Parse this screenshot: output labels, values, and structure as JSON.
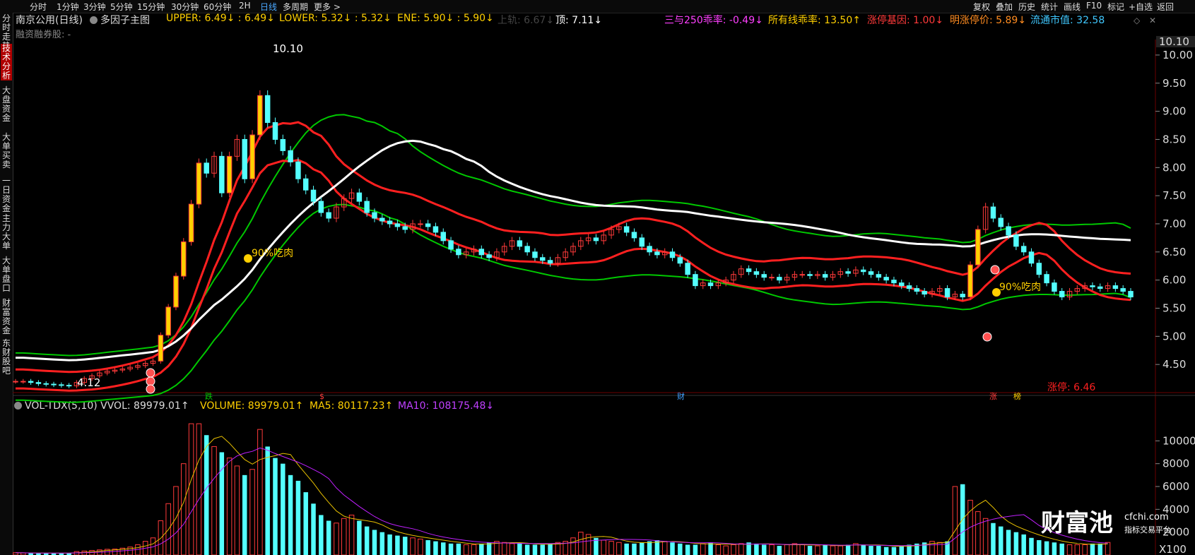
{
  "toolbar": {
    "periods": [
      "分时",
      "1分钟",
      "3分钟",
      "5分钟",
      "15分钟",
      "30分钟",
      "60分钟",
      "2H",
      "日线",
      "多周期",
      "更多 >"
    ],
    "actions": [
      "复权",
      "叠加",
      "历史",
      "统计",
      "画线",
      "F10",
      "标记",
      "+自选",
      "返回"
    ]
  },
  "sidebar": {
    "tabs": [
      "分时走势",
      "技术分析",
      "大盘资金",
      "大单买卖",
      "一日资金",
      "主力大单",
      "大单盘口",
      "财富资金",
      "东财股吧"
    ]
  },
  "header": {
    "stock_title": "南京公用(日线)",
    "indicator_name": "多因子主图",
    "upper": "UPPER: 6.49↓  : 6.49↓",
    "lower": "LOWER: 5.32↓  : 5.32↓",
    "ene": "ENE: 5.90↓  : 5.90↓",
    "shangui": "上轨: 6.67↓",
    "ding": "顶: 7.11↓",
    "sanyu": "三与250乖率: -0.49↓",
    "suoyou": "所有线乖率: 13.50↑",
    "zhangting_jiyin": "涨停基因: 1.00↓",
    "ming_zhangting": "明涨停价: 5.89↓",
    "liutong": "流通市值: 32.58",
    "margin": "融资融券股: -"
  },
  "colors": {
    "up": "#ff3a3a",
    "down": "#54ffff",
    "upper_band": "#ff2020",
    "outer_band": "#00c800",
    "mid_line": "#ffffff",
    "ma5": "#e8c000",
    "ma10": "#c020ff",
    "limit_up_bar": "#ffd000"
  },
  "price_axis": {
    "ticks": [
      "10.00",
      "9.50",
      "9.00",
      "8.50",
      "8.00",
      "7.50",
      "7.00",
      "6.50",
      "6.00",
      "5.50",
      "5.00",
      "4.50"
    ],
    "current_label": "10.10"
  },
  "annotations": {
    "high_label": "10.10",
    "low_label": "4.12",
    "chi_rou_1": "90%吃肉",
    "chi_rou_2": "90%吃肉",
    "limit_up_price": "涨停: 6.46",
    "marker_die": "跌",
    "marker_s": "$",
    "marker_cai": "财",
    "marker_zhang": "涨",
    "marker_bang": "榜"
  },
  "volume_panel": {
    "title": "VOL-TDX(5,10) VVOL: 89979.01↑",
    "volume": "VOLUME: 89979.01↑",
    "ma5": "MA5: 80117.23↑",
    "ma10": "MA10: 108175.48↓",
    "ticks": [
      "10000",
      "8000",
      "6000",
      "4000",
      "2000"
    ],
    "unit": "X100"
  },
  "watermark": {
    "brand": "财富池",
    "site": "cfchi.com",
    "slogan": "指标交易平台"
  },
  "chart_data": {
    "type": "candlestick",
    "ylim": [
      4.0,
      10.2
    ],
    "closes": [
      4.2,
      4.2,
      4.18,
      4.16,
      4.15,
      4.14,
      4.13,
      4.12,
      4.18,
      4.25,
      4.3,
      4.35,
      4.38,
      4.4,
      4.42,
      4.45,
      4.48,
      4.52,
      4.56,
      5.02,
      5.52,
      6.07,
      6.68,
      7.35,
      8.08,
      7.9,
      8.2,
      7.55,
      8.2,
      8.5,
      7.8,
      8.58,
      9.28,
      8.8,
      8.5,
      8.3,
      8.1,
      7.8,
      7.6,
      7.4,
      7.2,
      7.1,
      7.3,
      7.45,
      7.55,
      7.4,
      7.2,
      7.1,
      7.05,
      7.0,
      6.95,
      6.9,
      7.0,
      7.0,
      6.95,
      6.85,
      6.7,
      6.55,
      6.45,
      6.5,
      6.55,
      6.45,
      6.4,
      6.5,
      6.6,
      6.7,
      6.6,
      6.5,
      6.4,
      6.35,
      6.3,
      6.4,
      6.5,
      6.6,
      6.7,
      6.75,
      6.7,
      6.8,
      6.9,
      6.95,
      6.85,
      6.75,
      6.6,
      6.5,
      6.45,
      6.5,
      6.4,
      6.3,
      6.1,
      5.9,
      5.95,
      5.9,
      5.95,
      6.0,
      6.1,
      6.2,
      6.15,
      6.1,
      6.05,
      6.05,
      6.0,
      6.05,
      6.1,
      6.1,
      6.08,
      6.1,
      6.05,
      6.1,
      6.15,
      6.12,
      6.18,
      6.15,
      6.1,
      6.05,
      6.0,
      5.95,
      5.9,
      5.85,
      5.8,
      5.75,
      5.8,
      5.85,
      5.7,
      5.75,
      5.7,
      6.27,
      6.9,
      7.3,
      7.1,
      6.95,
      6.8,
      6.6,
      6.5,
      6.3,
      6.1,
      5.95,
      5.8,
      5.7,
      5.8,
      5.85,
      5.9,
      5.88,
      5.85,
      5.9,
      5.85,
      5.8,
      5.7
    ],
    "volumes": [
      200,
      180,
      160,
      150,
      150,
      160,
      170,
      180,
      300,
      350,
      400,
      450,
      500,
      520,
      600,
      700,
      900,
      1200,
      1500,
      3000,
      4500,
      6000,
      8000,
      11500,
      11500,
      10500,
      9500,
      9000,
      8500,
      7800,
      7000,
      7500,
      11000,
      9500,
      8500,
      8000,
      7000,
      6500,
      5500,
      4500,
      3500,
      3000,
      2800,
      3200,
      3500,
      3000,
      2500,
      2200,
      2000,
      1800,
      1700,
      1600,
      1500,
      1400,
      1300,
      1200,
      1100,
      1000,
      1000,
      900,
      900,
      1000,
      1100,
      1200,
      1100,
      1000,
      1000,
      900,
      900,
      900,
      1000,
      1100,
      1200,
      1500,
      2000,
      1800,
      1500,
      1300,
      1200,
      1100,
      1000,
      1000,
      1100,
      1200,
      1300,
      1200,
      1100,
      1000,
      900,
      900,
      1000,
      1100,
      900,
      800,
      900,
      1000,
      1100,
      1000,
      900,
      900,
      800,
      900,
      1000,
      900,
      800,
      800,
      900,
      800,
      800,
      900,
      1000,
      900,
      800,
      800,
      700,
      700,
      800,
      900,
      1000,
      1100,
      1200,
      1100,
      1200,
      6000,
      6200,
      4800,
      3800,
      3200,
      2800,
      2500,
      2200,
      2000,
      1800,
      1500,
      1300,
      1200,
      1100,
      1000,
      900,
      900,
      900,
      1000,
      1000,
      1100
    ]
  }
}
